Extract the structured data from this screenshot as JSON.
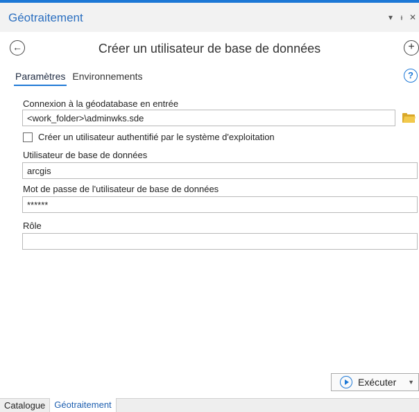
{
  "pane": {
    "title": "Géotraitement",
    "pin_icon": "pin-icon",
    "close_icon": "close-icon",
    "menu_icon": "chevron-down-icon"
  },
  "tool": {
    "title": "Créer un utilisateur de base de données",
    "back_icon": "back-arrow-icon",
    "add_icon": "add-icon"
  },
  "tabs": [
    {
      "label": "Paramètres",
      "active": true
    },
    {
      "label": "Environnements",
      "active": false
    }
  ],
  "form": {
    "connection_label": "Connexion à la géodatabase en entrée",
    "connection_value": "<work_folder>\\adminwks.sde",
    "os_auth_label": "Créer un utilisateur authentifié par le système d'exploitation",
    "os_auth_checked": false,
    "user_label": "Utilisateur de base de données",
    "user_value": "arcgis",
    "password_label": "Mot de passe de l'utilisateur de base de données",
    "password_value": "******",
    "role_label": "Rôle",
    "role_value": ""
  },
  "run_button": {
    "label": "Exécuter"
  },
  "bottom_tabs": [
    {
      "label": "Catalogue",
      "active": false
    },
    {
      "label": "Géotraitement",
      "active": true
    }
  ],
  "colors": {
    "accent": "#1d78d6",
    "folder": "#f2c94c"
  }
}
